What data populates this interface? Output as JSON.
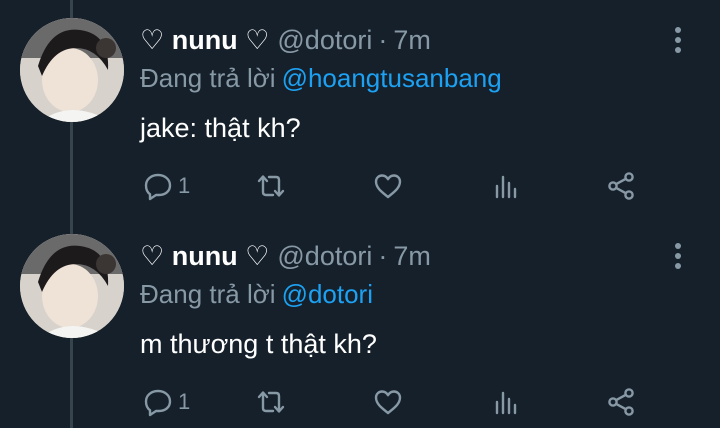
{
  "colors": {
    "background": "#15202b",
    "text": "#ffffff",
    "secondary": "#8899a6",
    "link": "#1da1f2",
    "thread_line": "#38444d"
  },
  "tweets": [
    {
      "display_name": "♡ nunu ♡",
      "handle": "@dotori",
      "separator": "·",
      "time": "7m",
      "reply_prefix": "Đang trả lời",
      "reply_to": "@hoangtusanbang",
      "text": "jake: thật kh?",
      "reply_count": "1",
      "icons": [
        "reply-icon",
        "retweet-icon",
        "heart-icon",
        "stats-icon",
        "share-icon",
        "more-options-icon"
      ]
    },
    {
      "display_name": "♡ nunu ♡",
      "handle": "@dotori",
      "separator": "·",
      "time": "7m",
      "reply_prefix": "Đang trả lời",
      "reply_to": "@dotori",
      "text": "m thương t thật kh?",
      "reply_count": "1",
      "icons": [
        "reply-icon",
        "retweet-icon",
        "heart-icon",
        "stats-icon",
        "share-icon",
        "more-options-icon"
      ]
    }
  ]
}
